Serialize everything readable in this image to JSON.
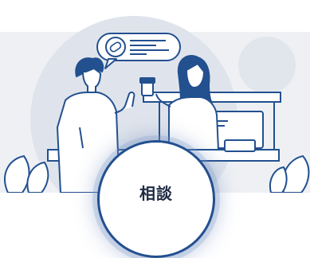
{
  "illustration": {
    "icons": [
      "speech-bubble-icon",
      "pill-icon",
      "medicine-bottle-icon",
      "computer-monitor-icon",
      "plant-icon"
    ]
  },
  "cta": {
    "label": "相談"
  },
  "colors": {
    "line": "#23508f",
    "background": "#eef0f4",
    "accent_light": "#dde3ee"
  }
}
